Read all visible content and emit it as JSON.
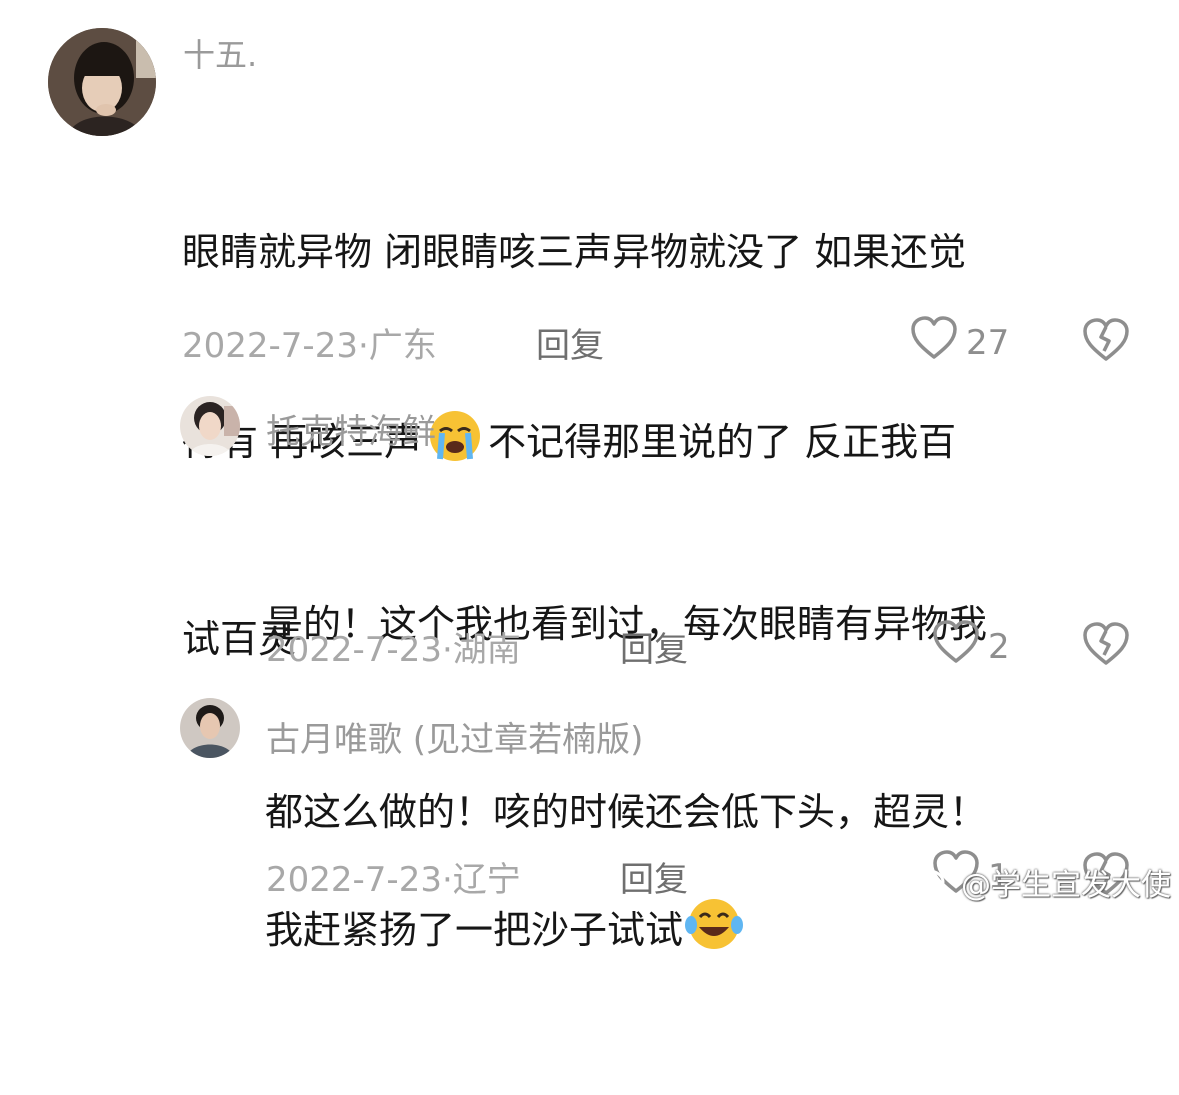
{
  "comments": [
    {
      "username": "十五.",
      "text_line1": "眼睛就异物 闭眼睛咳三声异物就没了 如果还觉",
      "text_before_emoji": "得有 再咳三声",
      "emoji": "loudly-crying-face",
      "text_after_emoji": "不记得那里说的了 反正我百",
      "text_line3": "试百灵",
      "date": "2022-7-23",
      "location": "广东",
      "reply_label": "回复",
      "likes": "27"
    },
    {
      "username": "托克特海鲜",
      "text_line1": "是的！这个我也看到过，每次眼睛有异物我",
      "text_line2": "都这么做的！咳的时候还会低下头，超灵！",
      "date": "2022-7-23",
      "location": "湖南",
      "reply_label": "回复",
      "likes": "2"
    },
    {
      "username": "古月唯歌 (见过章若楠版)",
      "text_before_emoji": "我赶紧扬了一把沙子试试",
      "emoji": "face-with-tears-of-joy",
      "date": "2022-7-23",
      "location": "辽宁",
      "reply_label": "回复",
      "likes": "1"
    }
  ],
  "meta_separator": "·",
  "watermark": "@学生宣发大使",
  "colors": {
    "text": "#161616",
    "username": "#9a9a9a",
    "meta": "#a8a8a8",
    "icon": "#8e8e8e",
    "emoji": "#f7c234"
  }
}
